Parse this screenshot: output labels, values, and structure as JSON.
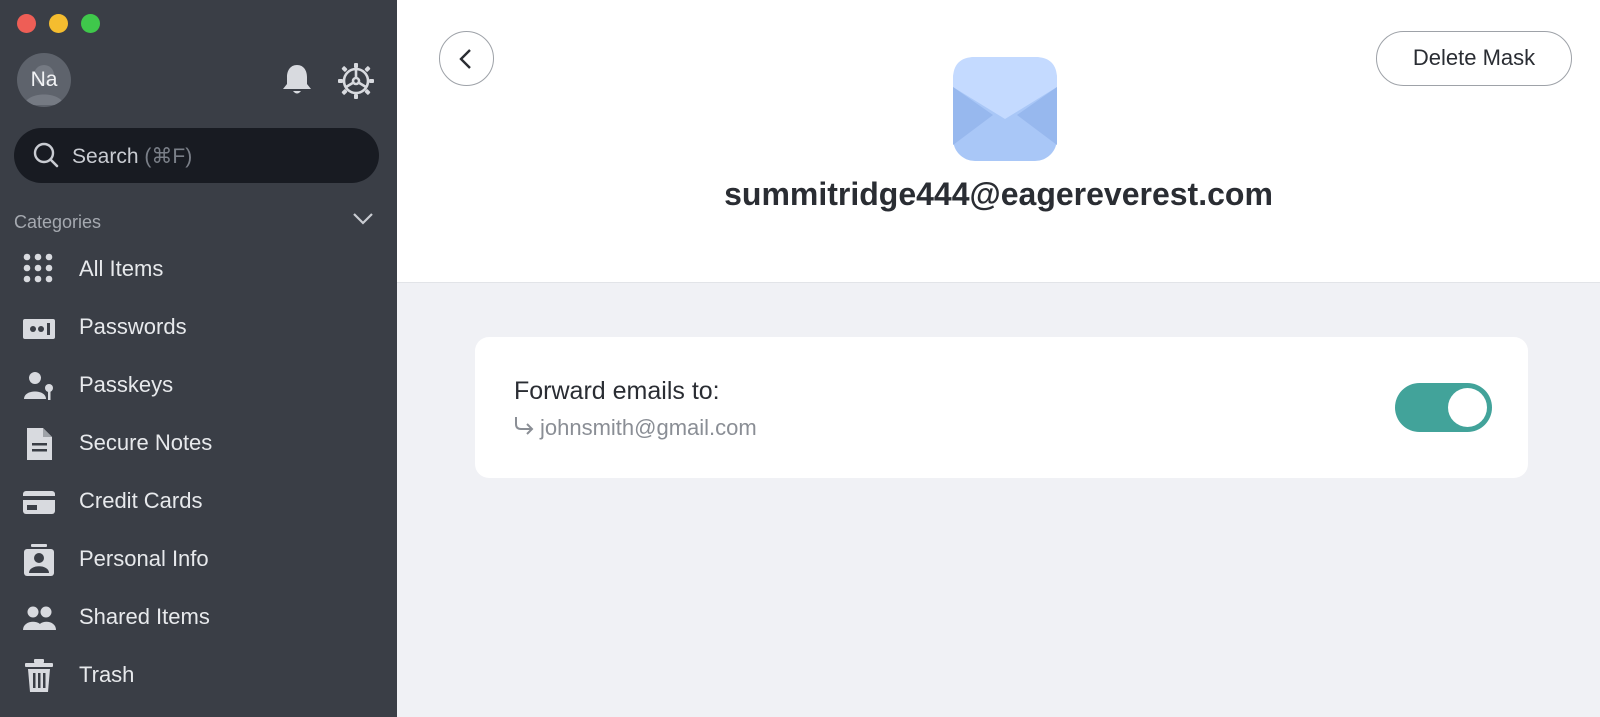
{
  "window": {
    "controls": [
      "close",
      "minimize",
      "zoom"
    ]
  },
  "sidebar": {
    "avatar_initials": "Na",
    "search": {
      "label": "Search",
      "shortcut": "(⌘F)"
    },
    "categories_title": "Categories",
    "items": [
      {
        "label": "All Items",
        "icon": "grid-icon"
      },
      {
        "label": "Passwords",
        "icon": "password-icon"
      },
      {
        "label": "Passkeys",
        "icon": "passkey-icon"
      },
      {
        "label": "Secure Notes",
        "icon": "note-icon"
      },
      {
        "label": "Credit Cards",
        "icon": "credit-card-icon"
      },
      {
        "label": "Personal Info",
        "icon": "id-card-icon"
      },
      {
        "label": "Shared Items",
        "icon": "people-icon"
      },
      {
        "label": "Trash",
        "icon": "trash-icon"
      }
    ]
  },
  "main": {
    "delete_label": "Delete Mask",
    "mask_email": "summitridge444@eagereverest.com",
    "forward": {
      "title": "Forward emails to:",
      "email": "johnsmith@gmail.com",
      "enabled": true
    }
  },
  "colors": {
    "sidebar_bg": "#3a3e46",
    "search_bg": "#181b22",
    "toggle_on": "#42a39a",
    "mail_icon": "#a9c7f7"
  }
}
